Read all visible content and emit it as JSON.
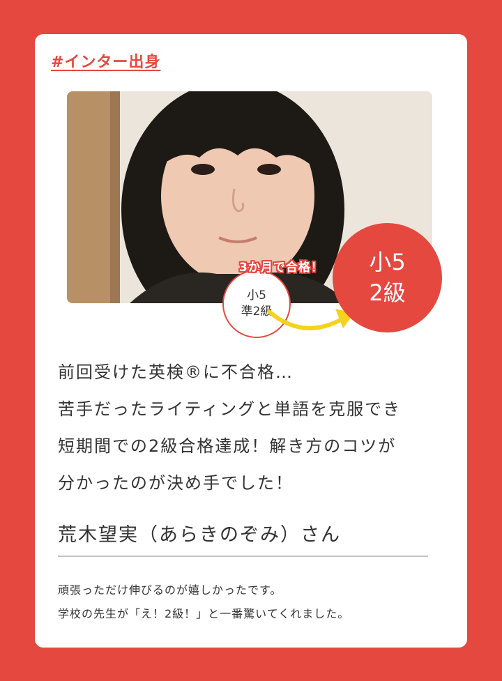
{
  "card": {
    "tag": "#インター出身",
    "photo": {
      "alt": "student-photo"
    },
    "badge_before": {
      "line1": "小5",
      "line2": "準2級"
    },
    "duration_label": "3か月で合格！",
    "badge_after": {
      "line1": "小5",
      "line2": "2級"
    },
    "message_lines": [
      "前回受けた英検®に不合格…",
      "苦手だったライティングと単語を克服でき",
      "短期間での2級合格達成！解き方のコツが",
      "分かったのが決め手でした！"
    ],
    "name": "荒木望実（あらきのぞみ）さん",
    "comment_lines": [
      "頑張っただけ伸びるのが嬉しかったです。",
      "学校の先生が「え！2級！」と一番驚いてくれました。"
    ]
  },
  "colors": {
    "background": "#e5483f",
    "accent": "#e5483f",
    "arrow": "#f5d21c",
    "card": "#ffffff"
  }
}
